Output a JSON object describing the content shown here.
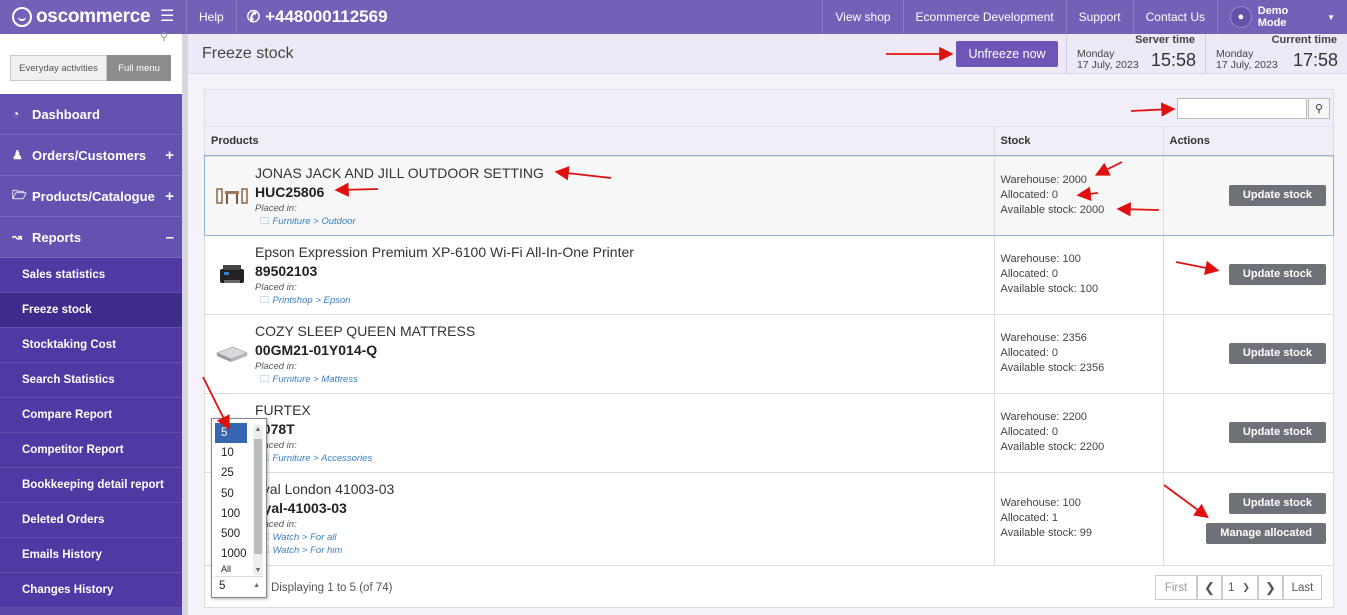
{
  "topbar": {
    "logo": "oscommerce",
    "help": "Help",
    "phone": "+448000112569",
    "links": [
      "View shop",
      "Ecommerce Development",
      "Support",
      "Contact Us"
    ],
    "user": "Demo Mode"
  },
  "sidebar": {
    "modes": {
      "everyday": "Everyday activities",
      "full": "Full menu"
    },
    "groups": [
      {
        "label": "Dashboard",
        "icon": "dashboard-icon"
      },
      {
        "label": "Orders/Customers",
        "icon": "users-icon"
      },
      {
        "label": "Products/Catalogue",
        "icon": "folder-icon"
      },
      {
        "label": "Reports",
        "icon": "chart-icon"
      }
    ],
    "report_items": [
      "Sales statistics",
      "Freeze stock",
      "Stocktaking Cost",
      "Search Statistics",
      "Compare Report",
      "Competitor Report",
      "Bookkeeping detail report",
      "Deleted Orders",
      "Emails History",
      "Changes History"
    ],
    "active": "Freeze stock"
  },
  "header": {
    "title": "Freeze stock",
    "unfreeze_label": "Unfreeze now",
    "server_time": {
      "label": "Server time",
      "day": "Monday",
      "date": "17 July, 2023",
      "time": "15:58"
    },
    "current_time": {
      "label": "Current time",
      "day": "Monday",
      "date": "17 July, 2023",
      "time": "17:58"
    }
  },
  "table": {
    "columns": [
      "Products",
      "Stock",
      "Actions"
    ],
    "placed_label": "Placed in:",
    "update_label": "Update stock",
    "manage_label": "Manage allocated",
    "rows": [
      {
        "name": "JONAS JACK AND JILL OUTDOOR SETTING",
        "code": "HUC25806",
        "cats": [
          [
            "Furniture",
            "Outdoor"
          ]
        ],
        "warehouse": "Warehouse: 2000",
        "allocated": "Allocated: 0",
        "available": "Available stock: 2000"
      },
      {
        "name": "Epson Expression Premium XP-6100 Wi-Fi All-In-One Printer",
        "code": "89502103",
        "cats": [
          [
            "Printshop",
            "Epson"
          ]
        ],
        "warehouse": "Warehouse: 100",
        "allocated": "Allocated: 0",
        "available": "Available stock: 100"
      },
      {
        "name": "COZY SLEEP QUEEN MATTRESS",
        "code": "00GM21-01Y014-Q",
        "cats": [
          [
            "Furniture",
            "Mattress"
          ]
        ],
        "warehouse": "Warehouse: 2356",
        "allocated": "Allocated: 0",
        "available": "Available stock: 2356"
      },
      {
        "name": "FURTEX",
        "code": "3078T",
        "cats": [
          [
            "Furniture",
            "Accessories"
          ]
        ],
        "warehouse": "Warehouse: 2200",
        "allocated": "Allocated: 0",
        "available": "Available stock: 2200"
      },
      {
        "name": "oyal London 41003-03",
        "code": "oyal-41003-03",
        "cats": [
          [
            "Watch",
            "For all"
          ],
          [
            "Watch",
            "For him"
          ]
        ],
        "warehouse": "Warehouse: 100",
        "allocated": "Allocated: 1",
        "available": "Available stock: 99"
      }
    ]
  },
  "pagination": {
    "displaying": "Displaying 1 to 5 (of 74)",
    "first": "First",
    "last": "Last",
    "page": "1",
    "per_page_options": [
      "5",
      "10",
      "25",
      "50",
      "100",
      "500",
      "1000",
      "All"
    ],
    "per_page_selected": "5"
  },
  "colors": {
    "brand": "#7560b8",
    "sidebar": "#5a46a8",
    "annotation": "#e01010"
  }
}
